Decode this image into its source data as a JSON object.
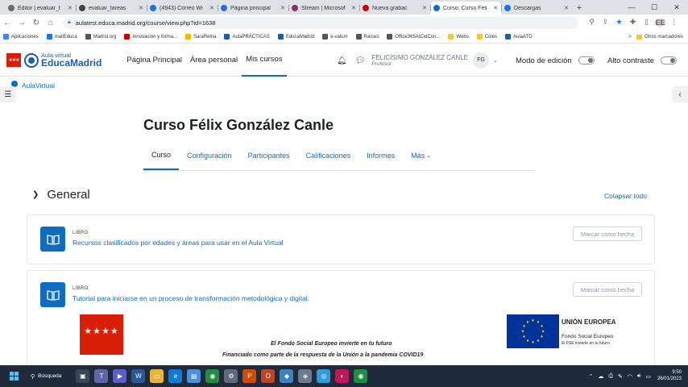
{
  "browser": {
    "tabs": [
      {
        "label": "Editor | evaluar_t",
        "color": "#6b6b6b",
        "active": false
      },
      {
        "label": "evaluar_tareas",
        "color": "#444",
        "active": false
      },
      {
        "label": "(4943) Correo Wi",
        "color": "#1a73e8",
        "active": false
      },
      {
        "label": "Página principal",
        "color": "#2b6fd6",
        "active": false
      },
      {
        "label": "Stream | Microsof",
        "color": "#8b2f6f",
        "active": false
      },
      {
        "label": "Nueva grabac",
        "color": "#c00",
        "active": false
      },
      {
        "label": "Curso: Curso Féli",
        "color": "#0f6cbf",
        "active": true
      },
      {
        "label": "Descargas",
        "color": "#1a73e8",
        "active": false
      }
    ],
    "new_tab": "+",
    "url": "aulatest.educa.madrid.org/course/view.php?id=1638",
    "profile_initials": "EE",
    "bookmarks": [
      {
        "label": "Aplicaciones",
        "color": "#4285f4"
      },
      {
        "label": "mailEduca",
        "color": "#1a73e8"
      },
      {
        "label": "Madrid.org",
        "color": "#555"
      },
      {
        "label": "Innovación y forma...",
        "color": "#c00"
      },
      {
        "label": "SaraReina",
        "color": "#f4b400"
      },
      {
        "label": "AulaPRÁCTICAS",
        "color": "#1a5fa8"
      },
      {
        "label": "EducaMadrid",
        "color": "#1a5fa8"
      },
      {
        "label": "e-valum",
        "color": "#555"
      },
      {
        "label": "Raíces",
        "color": "#555"
      },
      {
        "label": "Office365AtCidCon...",
        "color": "#555"
      },
      {
        "label": "Webs",
        "color": "#f4c542"
      },
      {
        "label": "Coles",
        "color": "#f4c542"
      },
      {
        "label": "AulaATD",
        "color": "#1a5fa8"
      }
    ],
    "bookmarks_more": "»",
    "other_bookmarks": "Otros marcadores"
  },
  "header": {
    "brand_sub": "Aula virtual",
    "brand_main": "EducaMadrid",
    "nav": [
      {
        "label": "Página Principal",
        "active": false
      },
      {
        "label": "Área personal",
        "active": false
      },
      {
        "label": "Mis cursos",
        "active": true
      }
    ],
    "user_name": "FELICÍSIMO GONZÁLEZ CANLE",
    "user_role": "Profesor",
    "user_initials": "FG",
    "edit_mode_label": "Modo de edición",
    "high_contrast_label": "Alto contraste"
  },
  "breadcrumb": "AulaVirtual",
  "course": {
    "title": "Curso Félix González Canle",
    "tabs": [
      {
        "label": "Curso",
        "active": true
      },
      {
        "label": "Configuración",
        "active": false
      },
      {
        "label": "Participantes",
        "active": false
      },
      {
        "label": "Calificaciones",
        "active": false
      },
      {
        "label": "Informes",
        "active": false
      },
      {
        "label": "Más",
        "active": false
      }
    ],
    "section_title": "General",
    "collapse_all": "Colapsar todo",
    "activities": [
      {
        "type": "LIBRO",
        "name": "Recursos clasificados por edades y áreas para usar en el Aula Virtual",
        "button": "Marcar como hecha"
      },
      {
        "type": "LIBRO",
        "name": "Tutorial para iniciarse en un proceso de transformación metodológica y digital.",
        "button": "Marcar como hecha"
      }
    ],
    "banner": {
      "line1": "El Fondo Social Europeo invierte en tu futuro",
      "line2": "Financiado como parte de la respuesta de la Unión a la pandemia COVID19",
      "eu_title": "UNIÓN EUROPEA",
      "eu_sub1": "Fondo Social Europeo",
      "eu_sub2": "El FSE invierte en tu futuro"
    }
  },
  "taskbar": {
    "search_label": "Búsqueda",
    "time": "9:50",
    "date": "26/01/2023"
  }
}
